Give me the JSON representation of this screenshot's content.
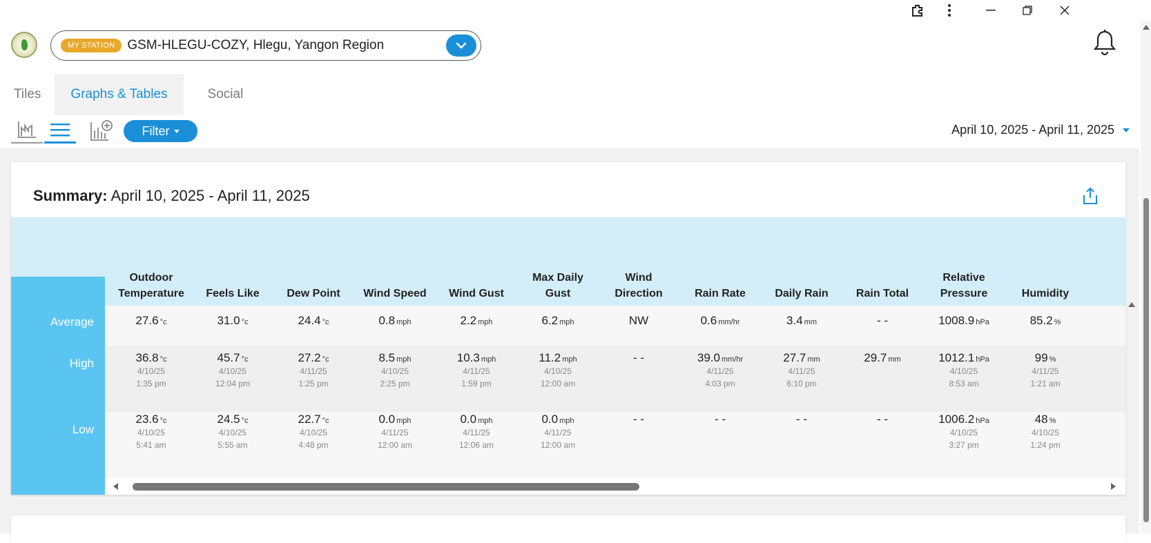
{
  "station": {
    "badge": "MY STATION",
    "name": "GSM-HLEGU-COZY, Hlegu, Yangon Region"
  },
  "tabs": [
    "Tiles",
    "Graphs & Tables",
    "Social"
  ],
  "toolbar": {
    "filter_label": "Filter",
    "date_range": "April 10, 2025 - April 11, 2025"
  },
  "summary": {
    "label": "Summary:",
    "range": "April 10, 2025 - April 11, 2025"
  },
  "table": {
    "row_labels": [
      "Average",
      "High",
      "Low"
    ],
    "columns": [
      {
        "h1": "Outdoor",
        "h2": "Temperature",
        "unit": "°c",
        "avg": "27.6",
        "high": {
          "v": "36.8",
          "d": "4/10/25",
          "t": "1:35 pm"
        },
        "low": {
          "v": "23.6",
          "d": "4/10/25",
          "t": "5:41 am"
        }
      },
      {
        "h1": "",
        "h2": "Feels Like",
        "unit": "°c",
        "avg": "31.0",
        "high": {
          "v": "45.7",
          "d": "4/10/25",
          "t": "12:04 pm"
        },
        "low": {
          "v": "24.5",
          "d": "4/10/25",
          "t": "5:55 am"
        }
      },
      {
        "h1": "",
        "h2": "Dew Point",
        "unit": "°c",
        "avg": "24.4",
        "high": {
          "v": "27.2",
          "d": "4/11/25",
          "t": "1:25 pm"
        },
        "low": {
          "v": "22.7",
          "d": "4/10/25",
          "t": "4:48 pm"
        }
      },
      {
        "h1": "",
        "h2": "Wind Speed",
        "unit": "mph",
        "avg": "0.8",
        "high": {
          "v": "8.5",
          "d": "4/10/25",
          "t": "2:25 pm"
        },
        "low": {
          "v": "0.0",
          "d": "4/11/25",
          "t": "12:00 am"
        }
      },
      {
        "h1": "",
        "h2": "Wind Gust",
        "unit": "mph",
        "avg": "2.2",
        "high": {
          "v": "10.3",
          "d": "4/11/25",
          "t": "1:59 pm"
        },
        "low": {
          "v": "0.0",
          "d": "4/11/25",
          "t": "12:06 am"
        }
      },
      {
        "h1": "Max Daily",
        "h2": "Gust",
        "unit": "mph",
        "avg": "6.2",
        "high": {
          "v": "11.2",
          "d": "4/10/25",
          "t": "12:00 am"
        },
        "low": {
          "v": "0.0",
          "d": "4/11/25",
          "t": "12:00 am"
        }
      },
      {
        "h1": "Wind",
        "h2": "Direction",
        "unit": "",
        "avg": "NW",
        "high": {
          "v": "- -",
          "d": "",
          "t": ""
        },
        "low": {
          "v": "- -",
          "d": "",
          "t": ""
        }
      },
      {
        "h1": "",
        "h2": "Rain Rate",
        "unit": "mm/hr",
        "avg": "0.6",
        "high": {
          "v": "39.0",
          "d": "4/11/25",
          "t": "4:03 pm"
        },
        "low": {
          "v": "- -",
          "d": "",
          "t": "",
          "nounit": true
        }
      },
      {
        "h1": "",
        "h2": "Daily Rain",
        "unit": "mm",
        "avg": "3.4",
        "high": {
          "v": "27.7",
          "d": "4/11/25",
          "t": "6:10 pm"
        },
        "low": {
          "v": "- -",
          "d": "",
          "t": "",
          "nounit": true
        }
      },
      {
        "h1": "",
        "h2": "Rain Total",
        "unit": "mm",
        "avg": "- -",
        "avg_nounit": true,
        "high": {
          "v": "29.7",
          "d": "",
          "t": ""
        },
        "low": {
          "v": "- -",
          "d": "",
          "t": "",
          "nounit": true
        }
      },
      {
        "h1": "Relative",
        "h2": "Pressure",
        "unit": "hPa",
        "avg": "1008.9",
        "high": {
          "v": "1012.1",
          "d": "4/10/25",
          "t": "8:53 am"
        },
        "low": {
          "v": "1006.2",
          "d": "4/10/25",
          "t": "3:27 pm"
        }
      },
      {
        "h1": "",
        "h2": "Humidity",
        "unit": "%",
        "avg": "85.2",
        "high": {
          "v": "99",
          "d": "4/11/25",
          "t": "1:21 am"
        },
        "low": {
          "v": "48",
          "d": "4/10/25",
          "t": "1:24 pm"
        }
      }
    ]
  }
}
